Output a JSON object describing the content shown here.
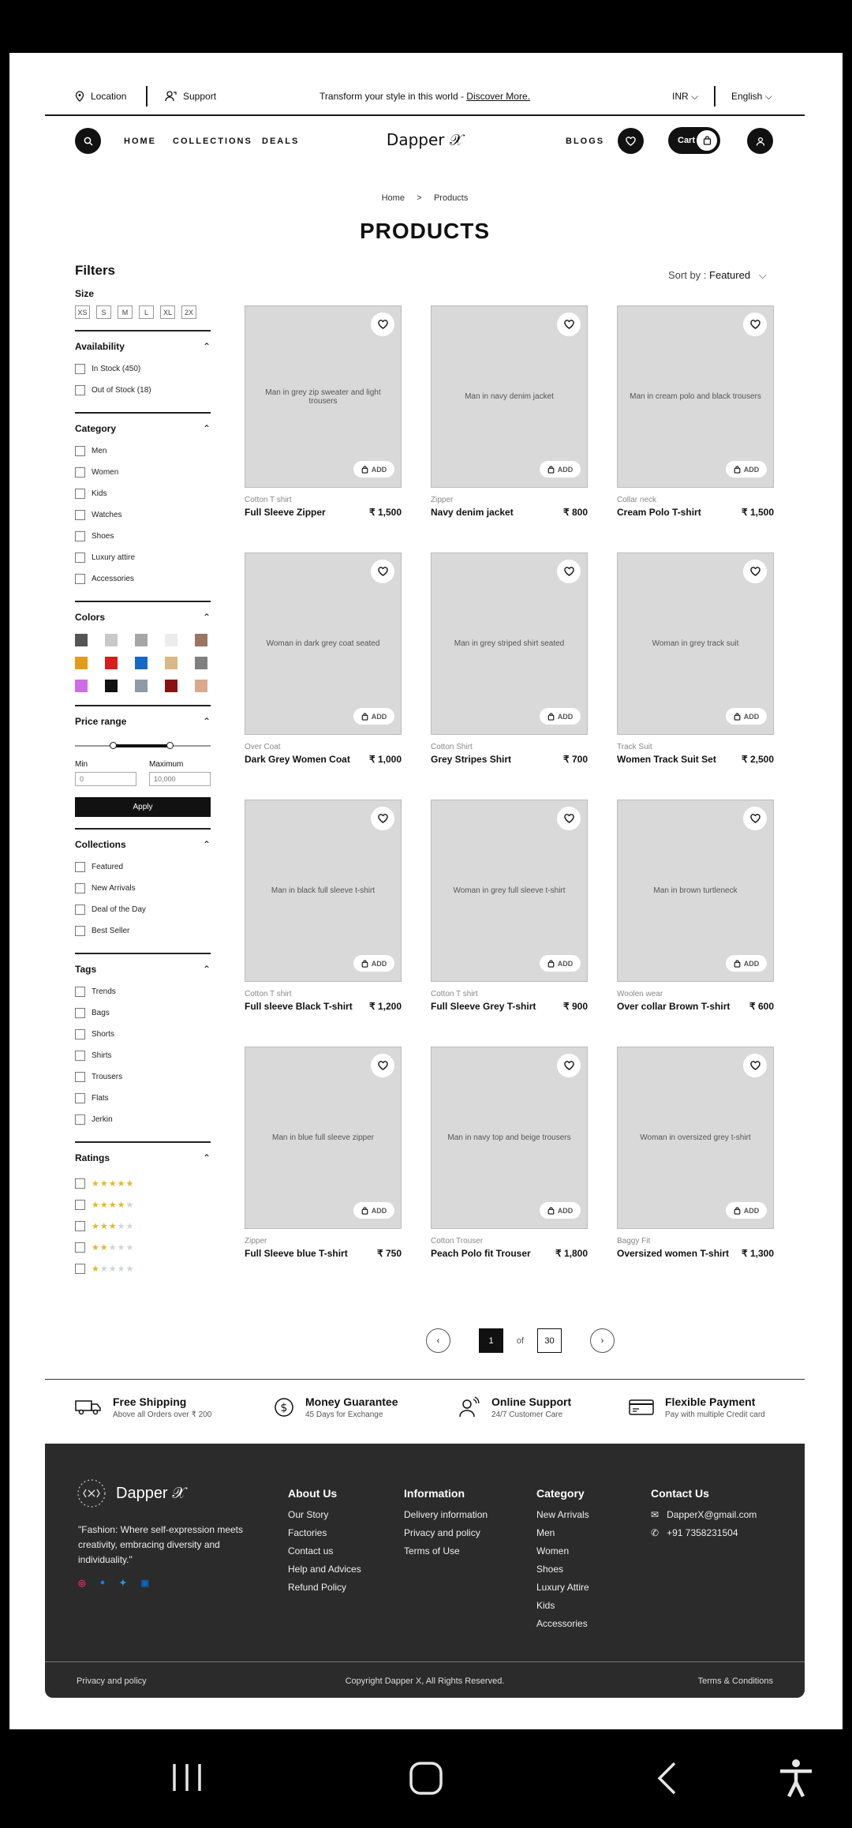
{
  "topbar": {
    "location": "Location",
    "support": "Support",
    "promo_text": "Transform your style in this world - ",
    "promo_link": "Discover More.",
    "currency": "INR ⌵",
    "language": "English ⌵"
  },
  "nav": {
    "home": "HOME",
    "collections": "COLLECTIONS",
    "deals": "DEALS",
    "brand": "Dapper 𝒳",
    "blogs": "BLOGS",
    "cart": "Cart"
  },
  "breadcrumb": {
    "home": "Home",
    "sep": ">",
    "current": "Products"
  },
  "title": "PRODUCTS",
  "sort": {
    "label": "Sort by : ",
    "value": "Featured",
    "chev": "⌵"
  },
  "filters": {
    "title": "Filters",
    "size_label": "Size",
    "sizes": [
      "XS",
      "S",
      "M",
      "L",
      "XL",
      "2X"
    ],
    "availability": {
      "label": "Availability",
      "options": [
        "In Stock (450)",
        "Out of Stock (18)"
      ]
    },
    "category": {
      "label": "Category",
      "options": [
        "Men",
        "Women",
        "Kids",
        "Watches",
        "Shoes",
        "Luxury attire",
        "Accessories"
      ]
    },
    "colors": {
      "label": "Colors",
      "swatches": [
        "#555555",
        "#c9c9c9",
        "#a6a6a6",
        "#ececec",
        "#9a7560",
        "#e39b1b",
        "#d91c1c",
        "#1669c7",
        "#d8b886",
        "#808080",
        "#cc6ee8",
        "#111111",
        "#8c9ba6",
        "#8b1111",
        "#d9a98a"
      ]
    },
    "price": {
      "label": "Price range",
      "min_label": "Min",
      "max_label": "Maximum",
      "min_placeholder": "0",
      "max_placeholder": "10,000",
      "apply": "Apply"
    },
    "collections": {
      "label": "Collections",
      "options": [
        "Featured",
        "New Arrivals",
        "Deal of the Day",
        "Best Seller"
      ]
    },
    "tags": {
      "label": "Tags",
      "options": [
        "Trends",
        "Bags",
        "Shorts",
        "Shirts",
        "Trousers",
        "Flats",
        "Jerkin"
      ]
    },
    "ratings": {
      "label": "Ratings",
      "values": [
        5,
        4,
        3,
        2,
        1
      ]
    }
  },
  "products": [
    {
      "category": "Cotton T shirt",
      "name": "Full Sleeve Zipper",
      "price": "₹ 1,500",
      "image": "Man in grey zip sweater and light trousers"
    },
    {
      "category": "Zipper",
      "name": "Navy denim jacket",
      "price": "₹ 800",
      "image": "Man in navy denim jacket"
    },
    {
      "category": "Collar neck",
      "name": "Cream Polo T-shirt",
      "price": "₹ 1,500",
      "image": "Man in cream polo and black trousers"
    },
    {
      "category": "Over Coat",
      "name": "Dark Grey Women Coat",
      "price": "₹ 1,000",
      "image": "Woman in dark grey coat seated"
    },
    {
      "category": "Cotton Shirt",
      "name": "Grey Stripes Shirt",
      "price": "₹ 700",
      "image": "Man in grey striped shirt seated"
    },
    {
      "category": "Track Suit",
      "name": "Women Track Suit Set",
      "price": "₹ 2,500",
      "image": "Woman in grey track suit"
    },
    {
      "category": "Cotton T shirt",
      "name": "Full sleeve Black T-shirt",
      "price": "₹ 1,200",
      "image": "Man in black full sleeve t-shirt"
    },
    {
      "category": "Cotton T shirt",
      "name": "Full Sleeve Grey T-shirt",
      "price": "₹ 900",
      "image": "Woman in grey full sleeve t-shirt"
    },
    {
      "category": "Woolen wear",
      "name": "Over collar Brown T-shirt",
      "price": "₹ 600",
      "image": "Man in brown turtleneck"
    },
    {
      "category": "Zipper",
      "name": "Full Sleeve blue T-shirt",
      "price": "₹ 750",
      "image": "Man in blue full sleeve zipper"
    },
    {
      "category": "Cotton Trouser",
      "name": "Peach Polo fit Trouser",
      "price": "₹ 1,800",
      "image": "Man in navy top and beige trousers"
    },
    {
      "category": "Baggy Fit",
      "name": "Oversized women T-shirt",
      "price": "₹ 1,300",
      "image": "Woman in oversized grey t-shirt"
    }
  ],
  "add_label": "ADD",
  "pager": {
    "prev": "‹",
    "current": "1",
    "of": "of",
    "total": "30",
    "next": "›"
  },
  "features": [
    {
      "title": "Free Shipping",
      "sub": "Above all Orders over ₹ 200"
    },
    {
      "title": "Money Guarantee",
      "sub": "45 Days for Exchange"
    },
    {
      "title": "Online Support",
      "sub": "24/7 Customer Care"
    },
    {
      "title": "Flexible Payment",
      "sub": "Pay with multiple Credit card"
    }
  ],
  "footer": {
    "brand": "Dapper 𝒳",
    "tagline": "\"Fashion: Where self-expression meets creativity, embracing diversity and individuality.\"",
    "about": {
      "title": "About Us",
      "links": [
        "Our Story",
        "Factories",
        "Contact us",
        "Help and Advices",
        "Refund Policy"
      ]
    },
    "info": {
      "title": "Information",
      "links": [
        "Delivery information",
        "Privacy and policy",
        "Terms of Use"
      ]
    },
    "category": {
      "title": "Category",
      "links": [
        "New Arrivals",
        "Men",
        "Women",
        "Shoes",
        "Luxury Attire",
        "Kids",
        "Accessories"
      ]
    },
    "contact": {
      "title": "Contact Us",
      "email": "DapperX@gmail.com",
      "phone": "+91 7358231504"
    },
    "bottom_left": "Privacy and policy",
    "copyright": "Copyright Dapper X, All Rights Reserved.",
    "bottom_right": "Terms & Conditions"
  }
}
